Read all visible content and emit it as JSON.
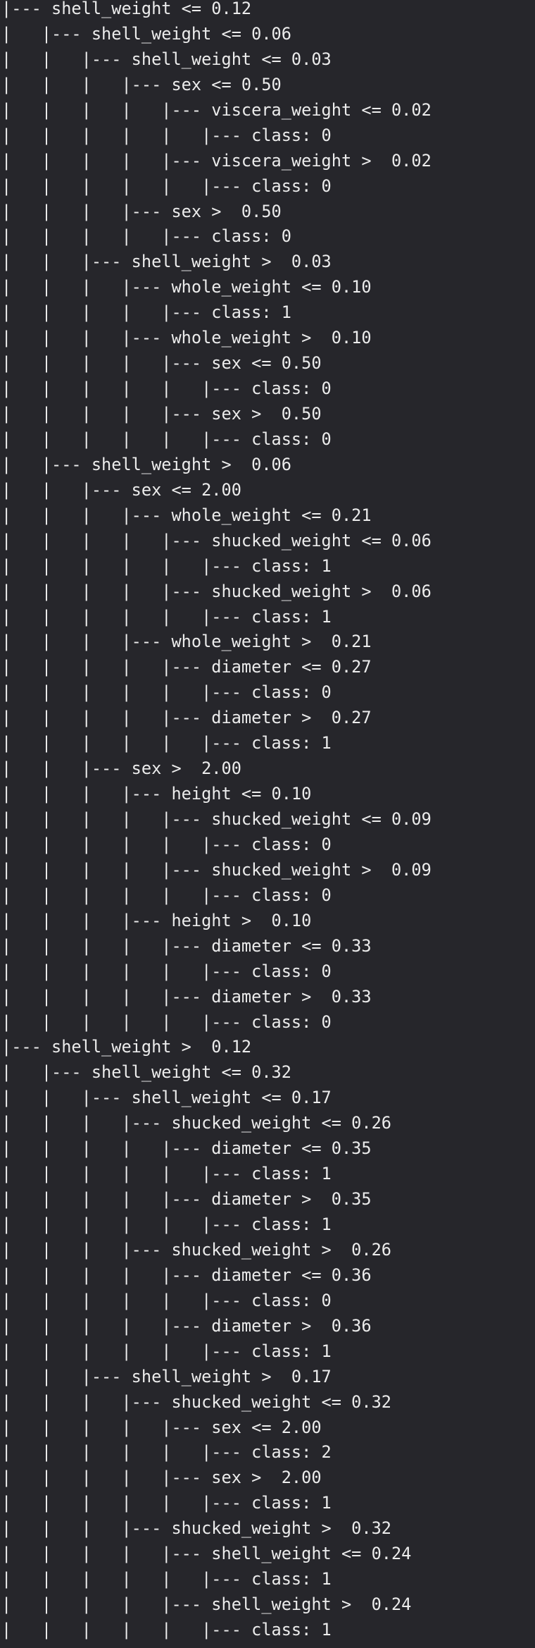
{
  "terminal": {
    "lines": [
      "|--- shell_weight <= 0.12",
      "|   |--- shell_weight <= 0.06",
      "|   |   |--- shell_weight <= 0.03",
      "|   |   |   |--- sex <= 0.50",
      "|   |   |   |   |--- viscera_weight <= 0.02",
      "|   |   |   |   |   |--- class: 0",
      "|   |   |   |   |--- viscera_weight >  0.02",
      "|   |   |   |   |   |--- class: 0",
      "|   |   |   |--- sex >  0.50",
      "|   |   |   |   |--- class: 0",
      "|   |   |--- shell_weight >  0.03",
      "|   |   |   |--- whole_weight <= 0.10",
      "|   |   |   |   |--- class: 1",
      "|   |   |   |--- whole_weight >  0.10",
      "|   |   |   |   |--- sex <= 0.50",
      "|   |   |   |   |   |--- class: 0",
      "|   |   |   |   |--- sex >  0.50",
      "|   |   |   |   |   |--- class: 0",
      "|   |--- shell_weight >  0.06",
      "|   |   |--- sex <= 2.00",
      "|   |   |   |--- whole_weight <= 0.21",
      "|   |   |   |   |--- shucked_weight <= 0.06",
      "|   |   |   |   |   |--- class: 1",
      "|   |   |   |   |--- shucked_weight >  0.06",
      "|   |   |   |   |   |--- class: 1",
      "|   |   |   |--- whole_weight >  0.21",
      "|   |   |   |   |--- diameter <= 0.27",
      "|   |   |   |   |   |--- class: 0",
      "|   |   |   |   |--- diameter >  0.27",
      "|   |   |   |   |   |--- class: 1",
      "|   |   |--- sex >  2.00",
      "|   |   |   |--- height <= 0.10",
      "|   |   |   |   |--- shucked_weight <= 0.09",
      "|   |   |   |   |   |--- class: 0",
      "|   |   |   |   |--- shucked_weight >  0.09",
      "|   |   |   |   |   |--- class: 0",
      "|   |   |   |--- height >  0.10",
      "|   |   |   |   |--- diameter <= 0.33",
      "|   |   |   |   |   |--- class: 0",
      "|   |   |   |   |--- diameter >  0.33",
      "|   |   |   |   |   |--- class: 0",
      "|--- shell_weight >  0.12",
      "|   |--- shell_weight <= 0.32",
      "|   |   |--- shell_weight <= 0.17",
      "|   |   |   |--- shucked_weight <= 0.26",
      "|   |   |   |   |--- diameter <= 0.35",
      "|   |   |   |   |   |--- class: 1",
      "|   |   |   |   |--- diameter >  0.35",
      "|   |   |   |   |   |--- class: 1",
      "|   |   |   |--- shucked_weight >  0.26",
      "|   |   |   |   |--- diameter <= 0.36",
      "|   |   |   |   |   |--- class: 0",
      "|   |   |   |   |--- diameter >  0.36",
      "|   |   |   |   |   |--- class: 1",
      "|   |   |--- shell_weight >  0.17",
      "|   |   |   |--- shucked_weight <= 0.32",
      "|   |   |   |   |--- sex <= 2.00",
      "|   |   |   |   |   |--- class: 2",
      "|   |   |   |   |--- sex >  2.00",
      "|   |   |   |   |   |--- class: 1",
      "|   |   |   |--- shucked_weight >  0.32",
      "|   |   |   |   |--- shell_weight <= 0.24",
      "|   |   |   |   |   |--- class: 1",
      "|   |   |   |   |--- shell_weight >  0.24",
      "|   |   |   |   |   |--- class: 1"
    ]
  }
}
